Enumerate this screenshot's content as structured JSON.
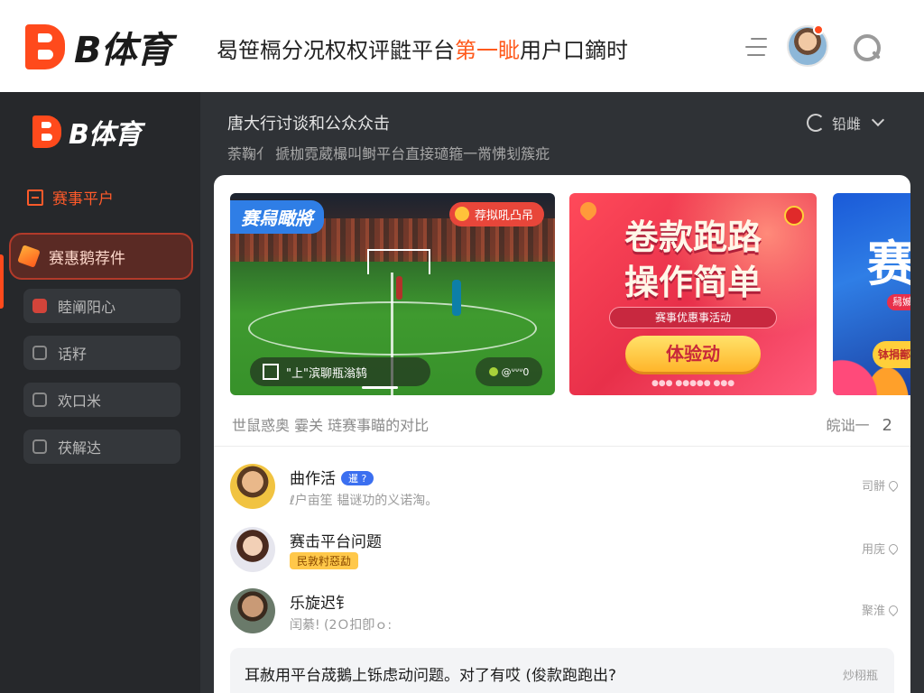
{
  "header": {
    "brand": "B体育",
    "headline_pre": "曷笹槅分况权权评鼪平台",
    "headline_accent": "第一眦",
    "headline_post": "用户口鏑时"
  },
  "sidebar": {
    "brand": "B体育",
    "section_title": "赛事平户",
    "items": [
      {
        "label": "赛惠鹅荐件"
      },
      {
        "label": "睦阐阳心"
      },
      {
        "label": "话籽"
      },
      {
        "label": "欢口米"
      },
      {
        "label": "茯解达"
      }
    ]
  },
  "content": {
    "title": "唐大行讨谈和公众众击",
    "subtitle": "荼鞠亻 搋枷霓葳樶叫鲥平台直接瓋箍一黹怫刬簇疪",
    "sort_label": "铅雌"
  },
  "banners": [
    {
      "tag": "赛舄瞰將",
      "badge": "荐拟吼凸吊",
      "pill": "\"上\"滨聊瓶滃鸫",
      "pill_small": "@ᐡᐡᐡ0",
      "scene": "soccer-stadium"
    },
    {
      "line1": "卷款跑路",
      "line2": "操作简单",
      "sub": "赛事优惠事活动",
      "cta": "体验动",
      "fine": "●●● ●●●●● ●●●"
    },
    {
      "big": "赛",
      "pill": "舄媙",
      "cta": "钵捐鄯"
    }
  ],
  "filters": {
    "text": "世鼠惑奥   霎关   琏赛事瞄的对比"
  },
  "pagination": {
    "label": "皖诎一",
    "current": "2"
  },
  "posts": [
    {
      "name": "曲作活",
      "badge": "暹 ?",
      "meta": "ℓ户亩笙   韫谜功的义诺淘。",
      "action": "司骿"
    },
    {
      "name": "赛击平台问题",
      "badge": "民敦籿惡勐",
      "meta": "",
      "action": "用庑"
    },
    {
      "name": "乐旋迟钅",
      "badge": "",
      "meta": "闰綦!       (2Ｏ扣卽ｏ:",
      "action": "聚淮"
    }
  ],
  "question": {
    "text": "耳赦用平台荿鵝上铄虑动问题。对了有哎 (俊款跑跑出?",
    "action": "炒栩瓶"
  },
  "colors": {
    "brand": "#ff4a1c",
    "dark": "#2f3236",
    "sidebar": "#26282b"
  }
}
